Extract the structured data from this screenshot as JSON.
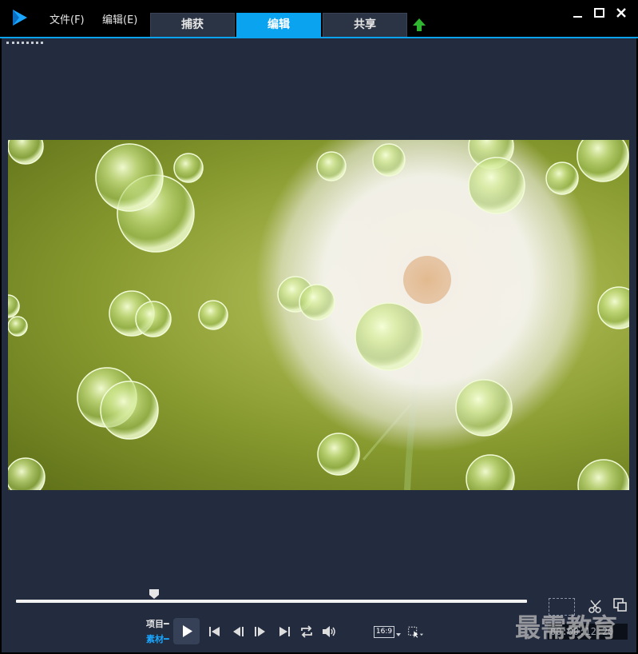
{
  "menu": {
    "file": "文件(F)",
    "edit": "编辑(E)"
  },
  "tabs": [
    {
      "label": "捕获",
      "active": false
    },
    {
      "label": "编辑",
      "active": true
    },
    {
      "label": "共享",
      "active": false
    }
  ],
  "accent_color": "#09a3ef",
  "window_buttons": [
    "minimize-icon",
    "maximize-icon",
    "close-icon"
  ],
  "playback": {
    "mode_labels": {
      "project": "项目",
      "clip": "素材"
    },
    "active_mode": "clip",
    "aspect_ratio": "16:9",
    "timecode": "00:00:12:20",
    "scrubber_position": 0.27
  },
  "watermark": "最需教育"
}
